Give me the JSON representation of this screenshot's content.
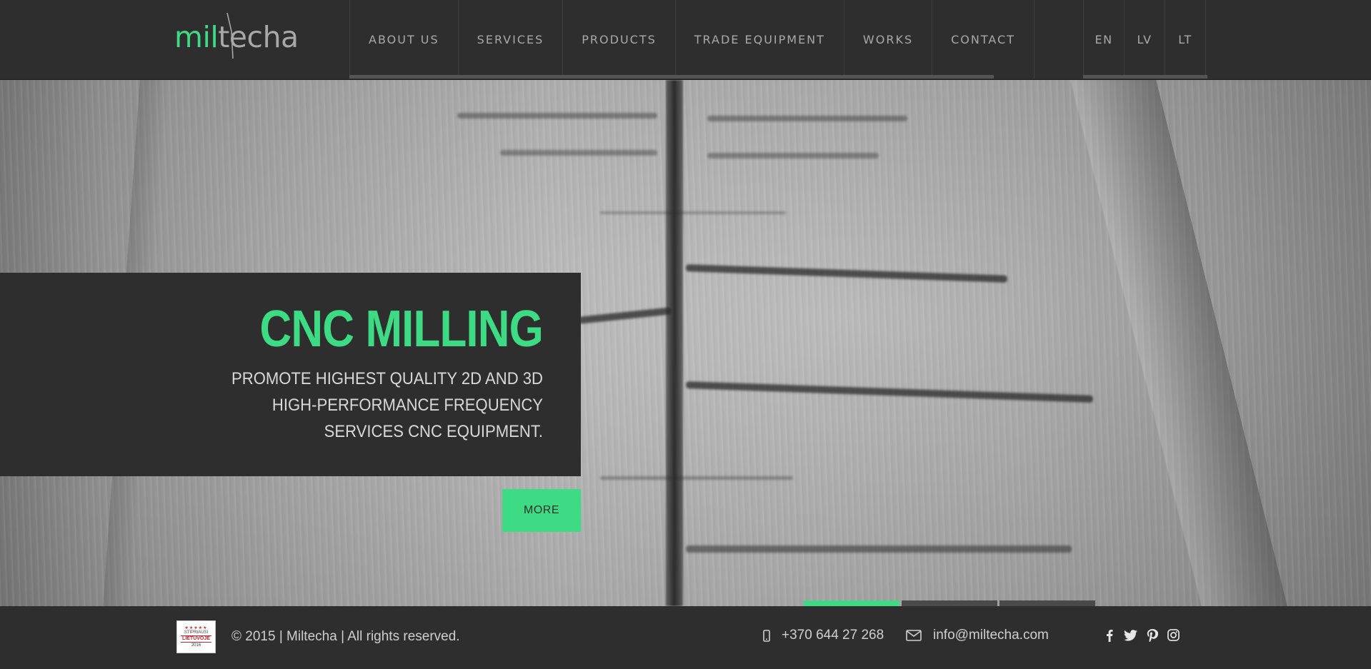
{
  "header": {
    "logo": {
      "part1": "mil",
      "part2": "techa"
    },
    "nav": [
      {
        "label": "ABOUT US"
      },
      {
        "label": "SERVICES"
      },
      {
        "label": "PRODUCTS"
      },
      {
        "label": "TRADE EQUIPMENT"
      },
      {
        "label": "WORKS"
      },
      {
        "label": "CONTACT"
      }
    ],
    "languages": [
      {
        "label": "EN"
      },
      {
        "label": "LV"
      },
      {
        "label": "LT"
      }
    ]
  },
  "hero": {
    "title": "CNC MILLING",
    "subtitle": "PROMOTE HIGHEST QUALITY 2D AND 3D HIGH-PERFORMANCE FREQUENCY SERVICES CNC EQUIPMENT.",
    "button_label": "MORE",
    "slider": {
      "total": 3,
      "active": 1
    }
  },
  "footer": {
    "badge": {
      "line1": "STIPRIAUSI",
      "line2": "LIETUVOJE",
      "line3": "2016"
    },
    "copyright": "© 2015 | Miltecha | All rights reserved.",
    "phone": "+370 644 27 268",
    "email": "info@miltecha.com",
    "social": [
      "facebook-icon",
      "twitter-icon",
      "pinterest-icon",
      "instagram-icon"
    ]
  },
  "colors": {
    "accent": "#3ddc84",
    "background": "#2e2e2e",
    "nav_text": "#a9a9a9"
  }
}
